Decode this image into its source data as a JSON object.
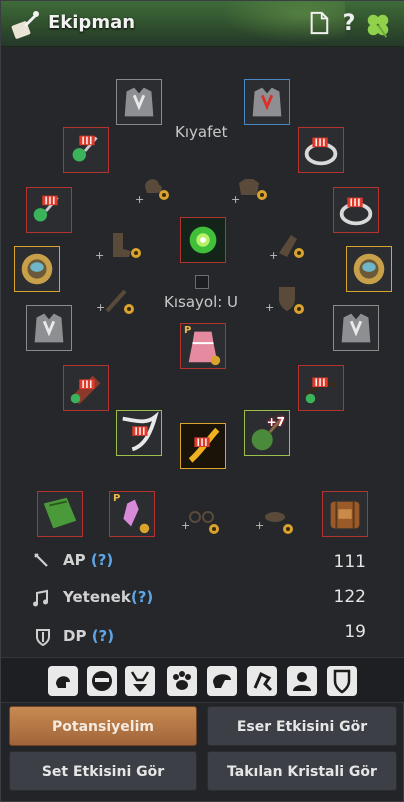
{
  "window": {
    "title": "Ekipman"
  },
  "header_icons": [
    "document-icon",
    "help-icon",
    "clover-icon"
  ],
  "header": {
    "help_glyph": "?"
  },
  "labels": {
    "outfit": "Kıyafet",
    "shortcut": "Kısayol: U"
  },
  "slot_markers": {
    "premium": "P",
    "enhance": "+7"
  },
  "stats": [
    {
      "label": "AP",
      "help": "(?)",
      "value": "111"
    },
    {
      "label": "Yetenek",
      "help": "(?)",
      "value": "122"
    },
    {
      "label": "DP",
      "help": "(?)",
      "value": "19"
    }
  ],
  "toggles": [
    "helmet-visibility",
    "mask-visibility",
    "underwear-visibility",
    "pet-visibility",
    "hair-visibility",
    "accessory-visibility",
    "silhouette-visibility",
    "armor-visibility"
  ],
  "buttons": {
    "potential": "Potansiyelim",
    "artifact": "Eser Etkisini Gör",
    "set_effect": "Set Etkisini Gör",
    "crystals": "Takılan Kristali Gör"
  },
  "colors": {
    "header_green": "#3f6b3a",
    "slot_red": "#b5332e",
    "slot_gold": "#d9a32c",
    "accent_help": "#5fa6e6",
    "primary_button": "#c98b52"
  }
}
